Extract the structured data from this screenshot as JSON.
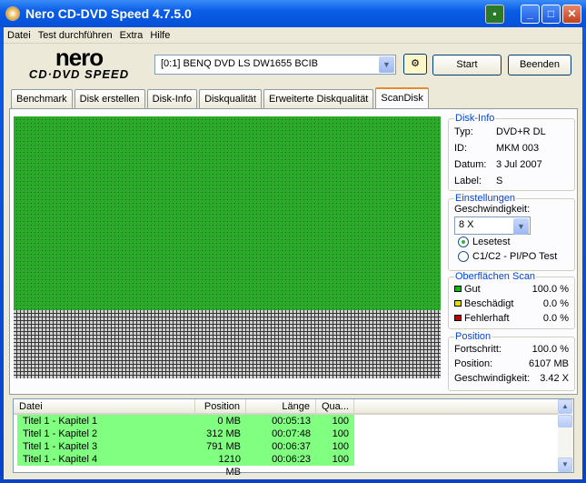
{
  "window": {
    "title": "Nero CD-DVD Speed 4.7.5.0"
  },
  "menu": [
    "Datei",
    "Test durchführen",
    "Extra",
    "Hilfe"
  ],
  "logo": {
    "line1": "nero",
    "line2": "CD·DVD SPEED"
  },
  "toolbar": {
    "drive": "[0:1]  BENQ DVD LS DW1655 BCIB",
    "start": "Start",
    "exit": "Beenden"
  },
  "tabs": [
    "Benchmark",
    "Disk erstellen",
    "Disk-Info",
    "Diskqualität",
    "Erweiterte Diskqualität",
    "ScanDisk"
  ],
  "active_tab": "ScanDisk",
  "disk_info": {
    "legend": "Disk-Info",
    "rows": [
      {
        "k": "Typ:",
        "v": "DVD+R DL"
      },
      {
        "k": "ID:",
        "v": "MKM 003"
      },
      {
        "k": "Datum:",
        "v": "3 Jul 2007"
      },
      {
        "k": "Label:",
        "v": "S"
      }
    ]
  },
  "settings": {
    "legend": "Einstellungen",
    "speed_label": "Geschwindigkeit:",
    "speed": "8 X",
    "opt1": "Lesetest",
    "opt2": "C1/C2 - PI/PO Test",
    "selected": "Lesetest"
  },
  "surface": {
    "legend": "Oberflächen Scan",
    "rows": [
      {
        "k": "Gut",
        "v": "100.0 %",
        "color": "#00c000"
      },
      {
        "k": "Beschädigt",
        "v": "0.0 %",
        "color": "#e0e000"
      },
      {
        "k": "Fehlerhaft",
        "v": "0.0 %",
        "color": "#c00000"
      }
    ]
  },
  "position": {
    "legend": "Position",
    "rows": [
      {
        "k": "Fortschritt:",
        "v": "100.0 %"
      },
      {
        "k": "Position:",
        "v": "6107 MB"
      },
      {
        "k": "Geschwindigkeit:",
        "v": "3.42 X"
      }
    ]
  },
  "scan_map": {
    "good_fraction_of_area": 0.74,
    "good_color": "#2fb82f",
    "unread_color": "#d0d0d0"
  },
  "file_list": {
    "columns": [
      "Datei",
      "Position",
      "Länge",
      "Qua..."
    ],
    "rows": [
      [
        "Titel 1 -  Kapitel 1",
        "0 MB",
        "00:05:13",
        "100"
      ],
      [
        "Titel 1 -  Kapitel 2",
        "312 MB",
        "00:07:48",
        "100"
      ],
      [
        "Titel 1 -  Kapitel 3",
        "791 MB",
        "00:06:37",
        "100"
      ],
      [
        "Titel 1 -  Kapitel 4",
        "1210 MB",
        "00:06:23",
        "100"
      ]
    ]
  }
}
